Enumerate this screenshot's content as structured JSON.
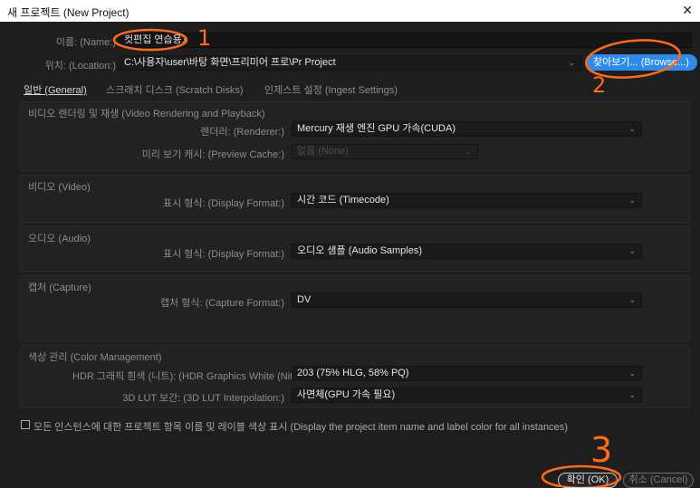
{
  "window": {
    "title": "새 프로젝트 (New Project)",
    "close_glyph": "✕"
  },
  "name": {
    "label": "이름: (Name:)",
    "value": "컷편집 연습용1"
  },
  "location": {
    "label": "위치: (Location:)",
    "value": "C:\\사용자\\user\\바탕 화면\\프리미어 프로\\Pr Project",
    "browse_label": "찾아보기... (Browse...)"
  },
  "tabs": [
    {
      "label": "일반 (General)",
      "active": true
    },
    {
      "label": "스크래치 디스크 (Scratch Disks)",
      "active": false
    },
    {
      "label": "인제스트 설정 (Ingest Settings)",
      "active": false
    }
  ],
  "video_rendering": {
    "title": "비디오 렌더링 및 재생 (Video Rendering and Playback)",
    "renderer_label": "렌더러: (Renderer:)",
    "renderer_value": "Mercury 재생 엔진 GPU 가속(CUDA)",
    "preview_cache_label": "미리 보기 캐시: (Preview Cache:)",
    "preview_cache_value": "없음 (None)"
  },
  "video": {
    "title": "비디오 (Video)",
    "display_format_label": "표시 형식: (Display Format:)",
    "display_format_value": "시간 코드 (Timecode)"
  },
  "audio": {
    "title": "오디오 (Audio)",
    "display_format_label": "표시 형식: (Display Format:)",
    "display_format_value": "오디오 샘플 (Audio Samples)"
  },
  "capture": {
    "title": "캡처 (Capture)",
    "capture_format_label": "캡처 형식: (Capture Format:)",
    "capture_format_value": "DV"
  },
  "color_management": {
    "title": "색상 관리 (Color Management)",
    "hdr_label": "HDR 그래픽 흰색 (니트): (HDR Graphics White (Nits):)",
    "hdr_value": "203 (75% HLG, 58% PQ)",
    "lut_label": "3D LUT 보간: (3D LUT Interpolation:)",
    "lut_value": "사면체(GPU 가속 필요)"
  },
  "display_option": {
    "label": "모든 인스턴스에 대한 프로젝트 항목 이름 및 레이블 색상 표시 (Display the project item name and label color for all instances)",
    "checked": false
  },
  "buttons": {
    "ok": "확인 (OK)",
    "cancel": "취소 (Cancel)"
  },
  "annotations": {
    "numbers": [
      "1",
      "2",
      "3"
    ],
    "color": "#ff6a13"
  },
  "colors": {
    "accent": "#2d8ceb",
    "background": "#1e1e1e"
  }
}
